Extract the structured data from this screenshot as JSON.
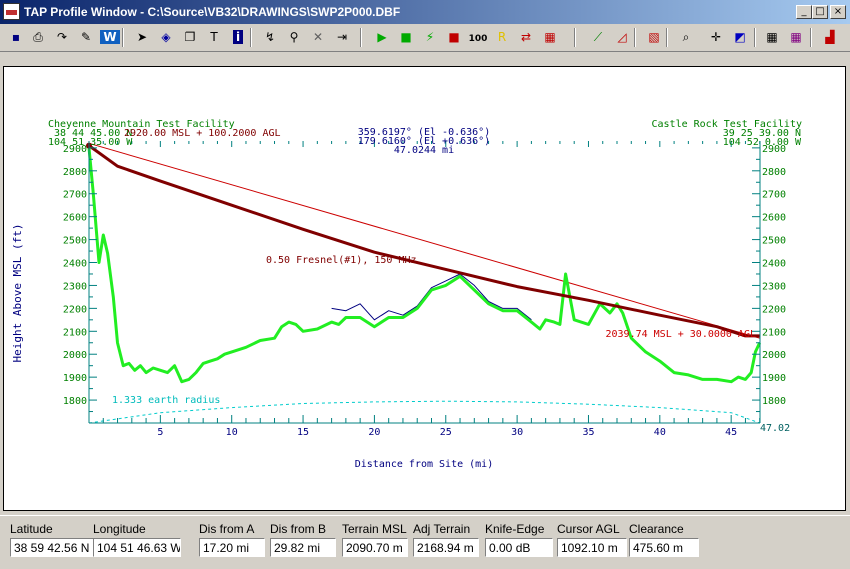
{
  "window": {
    "title": "TAP Profile Window - C:\\Source\\VB32\\DRAWINGS\\SWP2P000.DBF",
    "min_glyph": "_",
    "max_glyph": "□",
    "close_glyph": "×"
  },
  "toolbar": {
    "buttons": [
      {
        "name": "save-icon",
        "glyph": "▪",
        "color": "#000080"
      },
      {
        "name": "print-icon",
        "glyph": "⎙",
        "color": "#000000"
      },
      {
        "name": "redo-arrow-icon",
        "glyph": "↷",
        "color": "#000000"
      },
      {
        "name": "edit-notes-icon",
        "glyph": "✎",
        "color": "#000000"
      },
      {
        "name": "w-icon",
        "glyph": "W",
        "color": "#ffffff",
        "bg": "#1060c0"
      },
      {
        "name": "pointer-icon",
        "glyph": "➤",
        "color": "#000000"
      },
      {
        "name": "fill-icon",
        "glyph": "◈",
        "color": "#0000a0"
      },
      {
        "name": "copy-icon",
        "glyph": "❐",
        "color": "#000000"
      },
      {
        "name": "text-tool-icon",
        "glyph": "T",
        "color": "#000000"
      },
      {
        "name": "info-icon",
        "glyph": "i",
        "color": "#ffffff",
        "bg": "#000080"
      },
      {
        "name": "route-icon",
        "glyph": "↯",
        "color": "#000000"
      },
      {
        "name": "magnify-icon",
        "glyph": "⚲",
        "color": "#000000"
      },
      {
        "name": "delete-icon",
        "glyph": "✕",
        "color": "#606060"
      },
      {
        "name": "exit-icon",
        "glyph": "⇥",
        "color": "#000000"
      },
      {
        "name": "green-play-icon",
        "glyph": "▶",
        "color": "#00aa00"
      },
      {
        "name": "green-square-icon",
        "glyph": "■",
        "color": "#00aa00"
      },
      {
        "name": "green-wand-icon",
        "glyph": "⚡",
        "color": "#00aa00"
      },
      {
        "name": "red-square-icon",
        "glyph": "■",
        "color": "#c00000"
      },
      {
        "name": "zoom-100-icon",
        "glyph": "100",
        "color": "#000000"
      },
      {
        "name": "yellow-r-icon",
        "glyph": "R",
        "color": "#e0c000"
      },
      {
        "name": "red-swap-icon",
        "glyph": "⇄",
        "color": "#c00000"
      },
      {
        "name": "red-grid-icon",
        "glyph": "▦",
        "color": "#c00000"
      },
      {
        "name": "terrain-line-icon",
        "glyph": "⟋",
        "color": "#008000"
      },
      {
        "name": "terrain-fill-icon",
        "glyph": "◿",
        "color": "#c00000"
      },
      {
        "name": "hatch-icon",
        "glyph": "▧",
        "color": "#c00000"
      },
      {
        "name": "search-icon",
        "glyph": "⌕",
        "color": "#000000"
      },
      {
        "name": "crosshair-icon",
        "glyph": "✛",
        "color": "#000000"
      },
      {
        "name": "layers-icon",
        "glyph": "◩",
        "color": "#0000c0"
      },
      {
        "name": "color-grid-icon",
        "glyph": "▦",
        "color": "#000000"
      },
      {
        "name": "color-palette-icon",
        "glyph": "▦",
        "color": "#800080"
      },
      {
        "name": "bar-chart-icon",
        "glyph": "▟",
        "color": "#c00000"
      }
    ]
  },
  "chart_data": {
    "type": "line",
    "title_left": "Cheyenne Mountain Test Facility",
    "left_coords_1": "38 44 45.00 N",
    "left_coords_2": "104 51 35.00 W",
    "left_elev_label": "2920.00 MSL + 100.2000 AGL",
    "title_right": "Castle Rock Test Facility",
    "right_coords_1": "39 25 39.00 N",
    "right_coords_2": "104 52 0.00 W",
    "right_elev_label": "2039.74 MSL + 30.0000 AGL",
    "azimuth_1": "359.6197° (El -0.636°)",
    "azimuth_2": "179.6160° (El +0.636°)",
    "path_length": "47.0244 mi",
    "fresnel_label": "0.50 Fresnel(#1), 150 MHz",
    "earth_label": "1.333 earth radius",
    "xlabel": "Distance from Site (mi)",
    "ylabel": "Height Above MSL (ft)",
    "x_end_label": "47.02",
    "x_ticks": [
      5,
      10,
      15,
      20,
      25,
      30,
      35,
      40,
      45
    ],
    "y_ticks": [
      1800,
      1900,
      2000,
      2100,
      2200,
      2300,
      2400,
      2500,
      2600,
      2700,
      2800,
      2900
    ],
    "xlim": [
      0,
      47.02
    ],
    "ylim": [
      1700,
      2930
    ],
    "series": [
      {
        "role": "terrain",
        "color": "#22ee22",
        "x": [
          0,
          0.3,
          0.7,
          1.0,
          1.3,
          1.7,
          2.0,
          2.4,
          2.8,
          3.2,
          3.6,
          4.0,
          4.5,
          5.0,
          5.5,
          6.0,
          6.5,
          7.0,
          7.5,
          8.0,
          8.5,
          9.0,
          9.5,
          10.0,
          11.0,
          12.0,
          13.0,
          13.5,
          14.0,
          14.5,
          15.0,
          16.0,
          17.0,
          17.5,
          18.0,
          19.0,
          20.0,
          21.0,
          22.0,
          23.0,
          24.0,
          25.0,
          26.0,
          27.0,
          28.0,
          29.0,
          30.0,
          31.0,
          31.6,
          32.0,
          32.6,
          33.0,
          33.4,
          34.0,
          35.0,
          35.8,
          36.5,
          37.0,
          37.4,
          38.0,
          39.0,
          40.0,
          41.0,
          42.0,
          43.0,
          44.0,
          45.0,
          45.5,
          46.0,
          46.4,
          46.7,
          47.0
        ],
        "y": [
          2900,
          2700,
          2400,
          2520,
          2440,
          2250,
          2050,
          1950,
          1960,
          1930,
          1950,
          1920,
          1940,
          1930,
          1920,
          1950,
          1880,
          1890,
          1920,
          1960,
          1970,
          1980,
          2000,
          2010,
          2030,
          2060,
          2070,
          2120,
          2140,
          2130,
          2100,
          2110,
          2140,
          2130,
          2160,
          2160,
          2120,
          2160,
          2160,
          2200,
          2280,
          2300,
          2340,
          2280,
          2220,
          2190,
          2190,
          2140,
          2110,
          2150,
          2140,
          2130,
          2350,
          2150,
          2130,
          2220,
          2180,
          2220,
          2180,
          2070,
          2010,
          1970,
          1920,
          1910,
          1890,
          1890,
          1880,
          1900,
          1890,
          1920,
          2010,
          2050
        ]
      },
      {
        "role": "terrain-clutter",
        "color": "#000080",
        "x": [
          17.0,
          18.0,
          19.0,
          20.0,
          21.0,
          22.0,
          23.0,
          24.0,
          25.0,
          26.0,
          27.0,
          28.0,
          29.0,
          30.0,
          31.0
        ],
        "y": [
          2200,
          2190,
          2220,
          2150,
          2190,
          2170,
          2210,
          2290,
          2320,
          2350,
          2300,
          2230,
          2200,
          2200,
          2150
        ]
      },
      {
        "role": "fresnel",
        "color": "#800000",
        "x": [
          0,
          2,
          5,
          10,
          15,
          20,
          25,
          30,
          35,
          40,
          44,
          46,
          47
        ],
        "y": [
          2910,
          2820,
          2755,
          2650,
          2545,
          2445,
          2370,
          2295,
          2235,
          2170,
          2120,
          2080,
          2080
        ]
      },
      {
        "role": "line-of-sight",
        "color": "#cc0000",
        "x": [
          0,
          47
        ],
        "y": [
          2920,
          2070
        ]
      },
      {
        "role": "earth-curvature",
        "color": "#00cccc",
        "x": [
          0,
          5,
          10,
          15,
          20,
          25,
          30,
          35,
          40,
          45,
          47
        ],
        "y": [
          1700,
          1745,
          1767,
          1785,
          1792,
          1795,
          1792,
          1782,
          1767,
          1745,
          1700
        ]
      }
    ]
  },
  "status": {
    "fields": [
      {
        "label": "Latitude",
        "value": "38 59 42.56 N"
      },
      {
        "label": "Longitude",
        "value": "104 51 46.63 W"
      },
      {
        "label": "Dis from A",
        "value": "17.20 mi"
      },
      {
        "label": "Dis from B",
        "value": "29.82 mi"
      },
      {
        "label": "Terrain MSL",
        "value": "2090.70 m"
      },
      {
        "label": "Adj Terrain",
        "value": "2168.94 m"
      },
      {
        "label": "Knife-Edge",
        "value": "0.00 dB"
      },
      {
        "label": "Cursor AGL",
        "value": "1092.10 m"
      },
      {
        "label": "Clearance",
        "value": "475.60 m"
      }
    ]
  }
}
